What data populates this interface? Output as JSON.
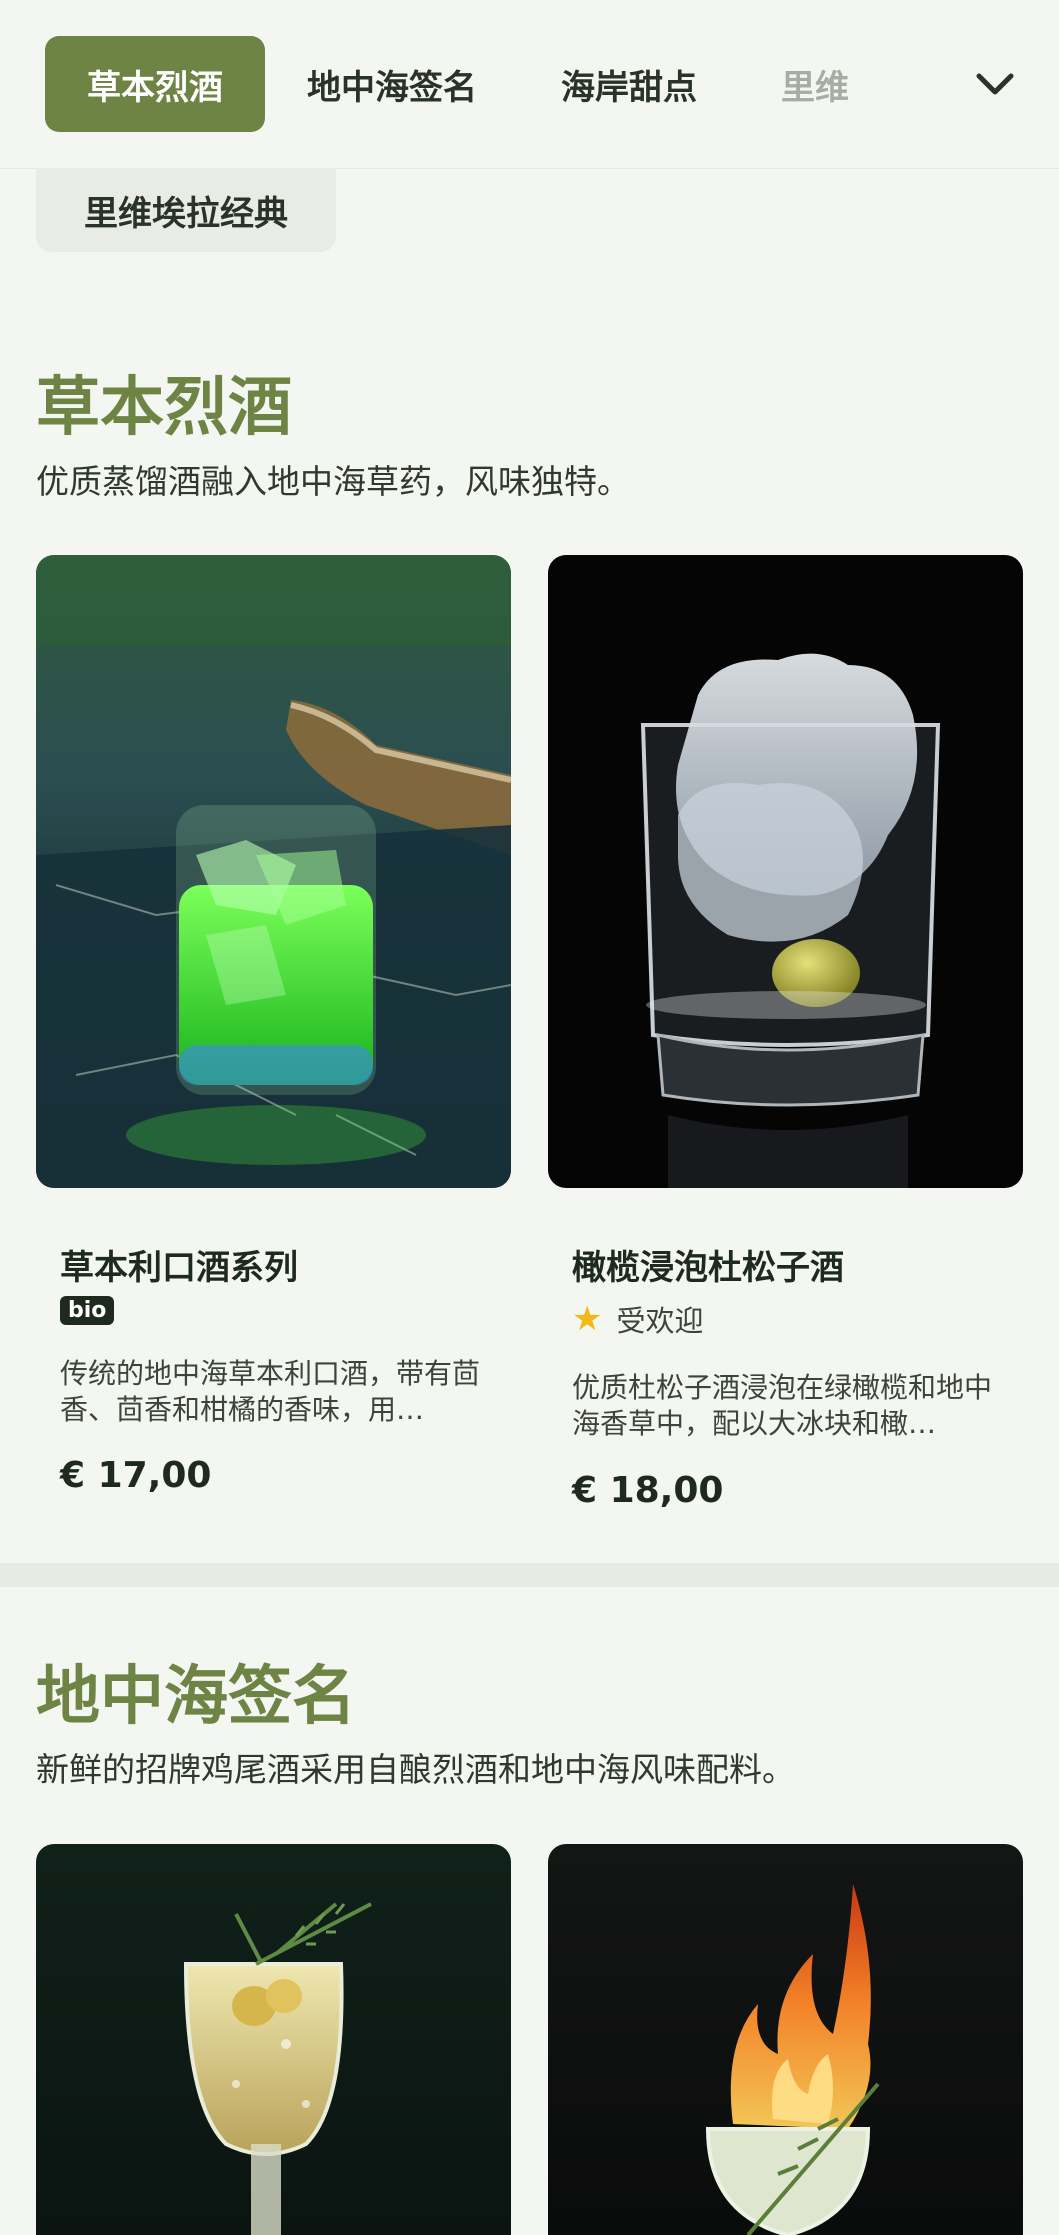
{
  "nav": {
    "tabs": [
      {
        "label": "草本烈酒",
        "active": true
      },
      {
        "label": "地中海签名",
        "active": false
      },
      {
        "label": "海岸甜点",
        "active": false
      },
      {
        "label": "里维",
        "active": false
      }
    ],
    "overflow_tab": "里维埃拉经典",
    "expand_icon": "chevron-down-icon"
  },
  "sections": [
    {
      "title": "草本烈酒",
      "description": "优质蒸馏酒融入地中海草药，风味独特。",
      "items": [
        {
          "name": "草本利口酒系列",
          "badge": "bio",
          "description": "传统的地中海草本利口酒，带有茴香、茴香和柑橘的香味，用…",
          "price": "€ 17,00"
        },
        {
          "name": "橄榄浸泡杜松子酒",
          "tag": "受欢迎",
          "description": "优质杜松子酒浸泡在绿橄榄和地中海香草中，配以大冰块和橄…",
          "price": "€ 18,00"
        }
      ]
    },
    {
      "title": "地中海签名",
      "description": "新鲜的招牌鸡尾酒采用自酿烈酒和地中海风味配料。"
    }
  ],
  "colors": {
    "accent": "#6d8445",
    "background": "#f3f6f1",
    "star": "#f2b91a"
  }
}
